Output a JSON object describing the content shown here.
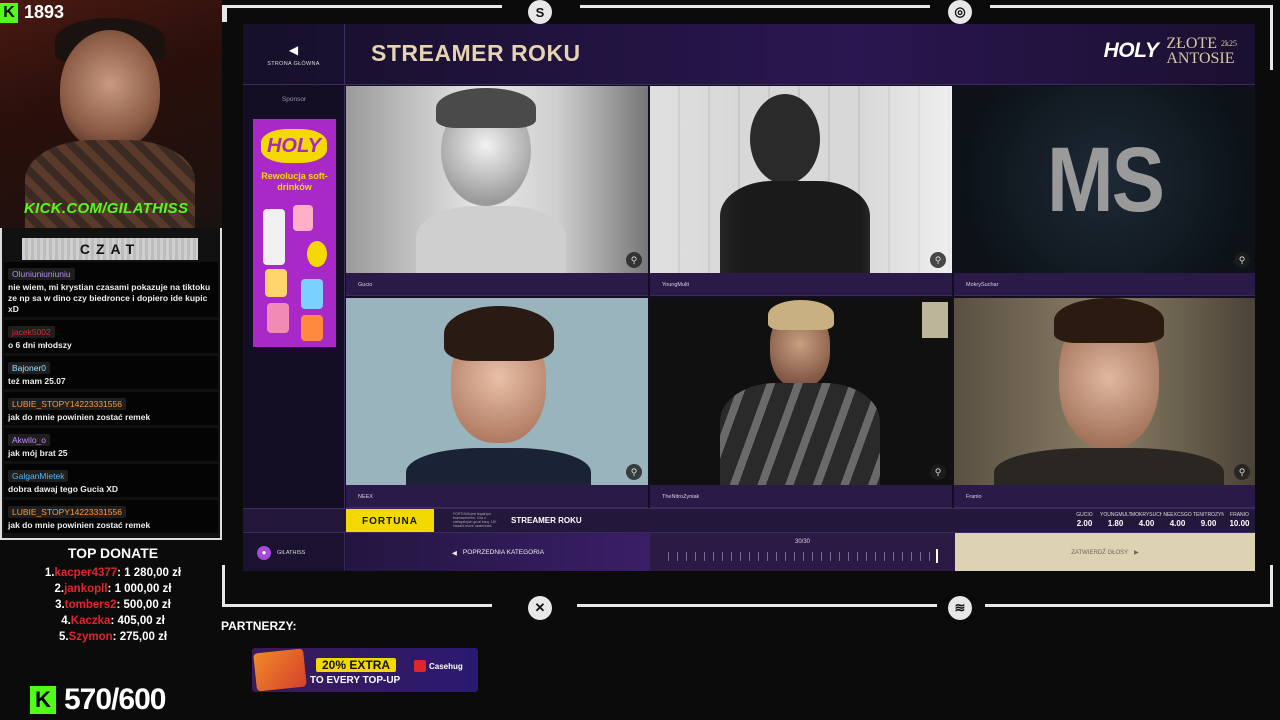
{
  "stream": {
    "viewers": "1893",
    "kick_url": "KICK.COM/GILATHISS",
    "goal": "570/600",
    "partners_label": "PARTNERZY:",
    "partner_ad": {
      "headline": "20% EXTRA",
      "sub": "TO EVERY TOP-UP",
      "brand": "Casehug"
    }
  },
  "chat": {
    "title": "CZAT",
    "messages": [
      {
        "user": "Oluniuniuniuniu",
        "user_color": "#b58cf0",
        "text": "nie wiem, mi krystian czasami pokazuje na tiktoku ze np sa w dino czy biedronce i dopiero ide kupic xD"
      },
      {
        "user": "jacek5002",
        "user_color": "#e0262b",
        "text": "o 6 dni młodszy"
      },
      {
        "user": "Bajoner0",
        "user_color": "#9ee2ff",
        "text": "też mam 25.07"
      },
      {
        "user": "LUBIE_STOPY14223331556",
        "user_color": "#ff9b3d",
        "text": "jak do mnie powinien zostać remek"
      },
      {
        "user": "Akwilo_o",
        "user_color": "#c58cff",
        "text": "jak mój brat 25"
      },
      {
        "user": "GalganMietek",
        "user_color": "#4fb6ff",
        "text": "dobra dawaj tego Gucia XD"
      },
      {
        "user": "LUBIE_STOPY14223331556",
        "user_color": "#ff9b3d",
        "text": "jak do mnie powinien zostać remek"
      }
    ]
  },
  "top_donate": {
    "title": "TOP DONATE",
    "donors": [
      {
        "n": "1.",
        "name": "kacper4377",
        "amount": ": 1 280,00 zł"
      },
      {
        "n": "2.",
        "name": "jankopll",
        "amount": ": 1 000,00 zł"
      },
      {
        "n": "3.",
        "name": "tombers2",
        "amount": ": 500,00 zł"
      },
      {
        "n": "4.",
        "name": "Kaczka",
        "amount": ": 405,00 zł"
      },
      {
        "n": "5.",
        "name": "Szymon",
        "amount": ": 275,00 zł"
      }
    ]
  },
  "app": {
    "back_label": "STRONA GŁÓWNA",
    "title": "STREAMER ROKU",
    "brand_holy": "HOLY",
    "brand_line1": "ZŁOTE",
    "brand_line2": "ANTOSIE",
    "brand_year": "2k25",
    "sponsor_label": "Sponsor",
    "sponsor_ad": {
      "logo": "HOLY",
      "slogan": "Rewolucja soft-drinków"
    },
    "nominees": [
      {
        "name": "Gucio"
      },
      {
        "name": "YoungMulti"
      },
      {
        "name": "MokrySuchar",
        "initials": "MS"
      },
      {
        "name": "NEEX"
      },
      {
        "name": "TheNitroZyniak"
      },
      {
        "name": "Franio"
      }
    ],
    "odds_brand": "FORTUNA",
    "odds_fine_print": "FORTUNA jest legalnym bukmacherem. Gra u nielegalnych grozi karą. 18+ Hazard może uzależniać.",
    "odds_title": "STREAMER ROKU",
    "odds": [
      {
        "name": "GUCIO",
        "value": "2.00"
      },
      {
        "name": "YOUNGMULTI",
        "value": "1.80"
      },
      {
        "name": "MOKRYSUCHAR",
        "value": "4.00"
      },
      {
        "name": "NEEXCSGO",
        "value": "4.00"
      },
      {
        "name": "TENITROZYNIAK",
        "value": "9.00"
      },
      {
        "name": "FRANIO",
        "value": "10.00"
      }
    ],
    "user": "GILATHISS",
    "prev_category": "POPRZEDNIA KATEGORIA",
    "progress_text": "30/30",
    "progress": 1.0,
    "confirm_label": "ZATWIERDŹ GŁOSY"
  },
  "colors": {
    "accent_gold": "#e6d3b0",
    "kick_green": "#53fc18",
    "fortuna_yellow": "#f4d900",
    "purple": "#2a1a48"
  }
}
